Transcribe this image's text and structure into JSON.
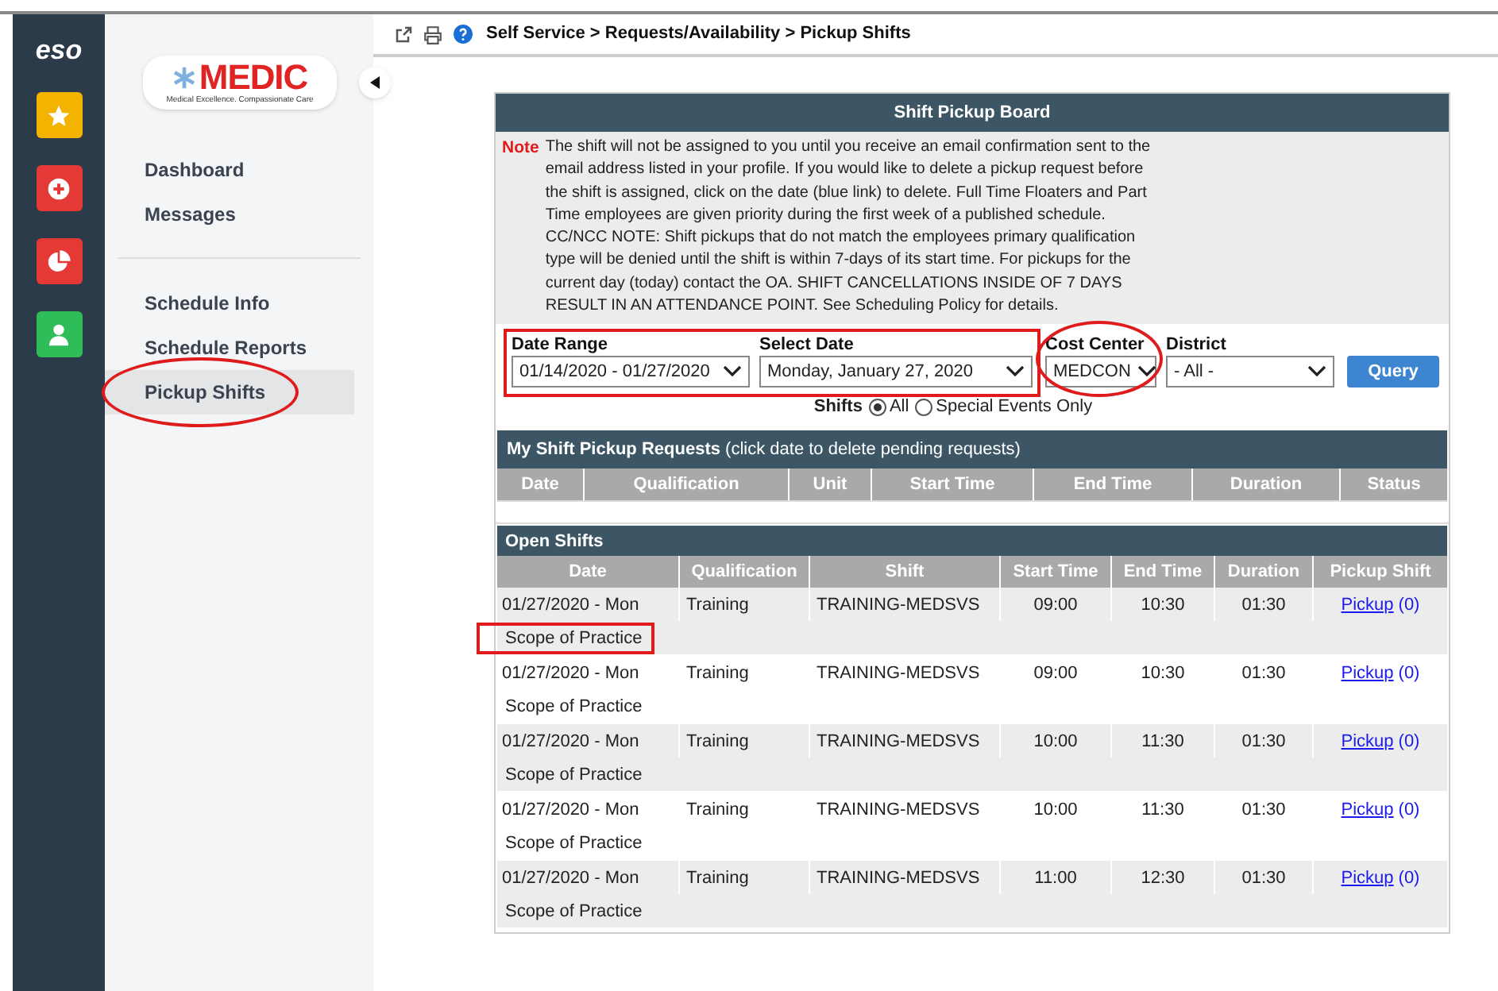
{
  "rail": {
    "logo": "eso",
    "apps": [
      {
        "kind": "star",
        "color": "#f5b301"
      },
      {
        "kind": "plus",
        "color": "#e53935"
      },
      {
        "kind": "pie",
        "color": "#e53935"
      },
      {
        "kind": "user",
        "color": "#2ebd59"
      }
    ]
  },
  "sidebar": {
    "logo": {
      "title": "MEDIC",
      "tagline": "Medical Excellence. Compassionate Care"
    },
    "groups": [
      [
        {
          "label": "Dashboard",
          "selected": false,
          "circled": false
        },
        {
          "label": "Messages",
          "selected": false,
          "circled": false
        }
      ],
      [
        {
          "label": "Schedule Info",
          "selected": false,
          "circled": false
        },
        {
          "label": "Schedule Reports",
          "selected": false,
          "circled": false
        },
        {
          "label": "Pickup Shifts",
          "selected": true,
          "circled": true
        }
      ]
    ]
  },
  "breadcrumb": "Self Service > Requests/Availability > Pickup Shifts",
  "board": {
    "title": "Shift Pickup Board",
    "note_label": "Note",
    "note": "The shift will not be assigned to you until you receive an email confirmation sent to the email address listed in your profile. If you would like to delete a pickup request before the shift is assigned, click on the date (blue link) to delete. Full Time Floaters and Part Time employees are given priority during the first week of a published schedule. CC/NCC NOTE: Shift pickups that do not match the employees primary qualification type will be denied until the shift is within 7-days of its start time. For pickups for the current day (today) contact the OA. SHIFT CANCELLATIONS INSIDE OF 7 DAYS RESULT IN AN ATTENDANCE POINT. See Scheduling Policy for details.",
    "filters": [
      {
        "label": "Date Range",
        "value": "01/14/2020 - 01/27/2020",
        "boxed": true,
        "circled": false
      },
      {
        "label": "Select Date",
        "value": "Monday, January 27, 2020",
        "boxed": true,
        "circled": false
      },
      {
        "label": "Cost Center",
        "value": "MEDCON",
        "boxed": false,
        "circled": true
      },
      {
        "label": "District",
        "value": "- All -",
        "boxed": false,
        "circled": false
      }
    ],
    "query_button": "Query",
    "shifts_label": "Shifts",
    "shift_options": [
      {
        "label": "All",
        "selected": true
      },
      {
        "label": "Special Events Only",
        "selected": false
      }
    ],
    "requests": {
      "title": "My Shift Pickup Requests",
      "hint": "(click date to delete pending requests)",
      "columns": [
        "Date",
        "Qualification",
        "Unit",
        "Start Time",
        "End Time",
        "Duration",
        "Status"
      ]
    },
    "open_shifts": {
      "title": "Open Shifts",
      "columns": [
        "Date",
        "Qualification",
        "Shift",
        "Start Time",
        "End Time",
        "Duration",
        "Pickup Shift"
      ],
      "rows": [
        {
          "date": "01/27/2020 - Mon",
          "qualification": "Training",
          "shift": "TRAINING-MEDSVS",
          "start": "09:00",
          "end": "10:30",
          "duration": "01:30",
          "link": "Pickup",
          "count": "(0)",
          "note": "Scope of Practice",
          "note_boxed": true
        },
        {
          "date": "01/27/2020 - Mon",
          "qualification": "Training",
          "shift": "TRAINING-MEDSVS",
          "start": "09:00",
          "end": "10:30",
          "duration": "01:30",
          "link": "Pickup",
          "count": "(0)",
          "note": "Scope of Practice",
          "note_boxed": false
        },
        {
          "date": "01/27/2020 - Mon",
          "qualification": "Training",
          "shift": "TRAINING-MEDSVS",
          "start": "10:00",
          "end": "11:30",
          "duration": "01:30",
          "link": "Pickup",
          "count": "(0)",
          "note": "Scope of Practice",
          "note_boxed": false
        },
        {
          "date": "01/27/2020 - Mon",
          "qualification": "Training",
          "shift": "TRAINING-MEDSVS",
          "start": "10:00",
          "end": "11:30",
          "duration": "01:30",
          "link": "Pickup",
          "count": "(0)",
          "note": "Scope of Practice",
          "note_boxed": false
        },
        {
          "date": "01/27/2020 - Mon",
          "qualification": "Training",
          "shift": "TRAINING-MEDSVS",
          "start": "11:00",
          "end": "12:30",
          "duration": "01:30",
          "link": "Pickup",
          "count": "(0)",
          "note": "Scope of Practice",
          "note_boxed": false
        }
      ]
    }
  }
}
